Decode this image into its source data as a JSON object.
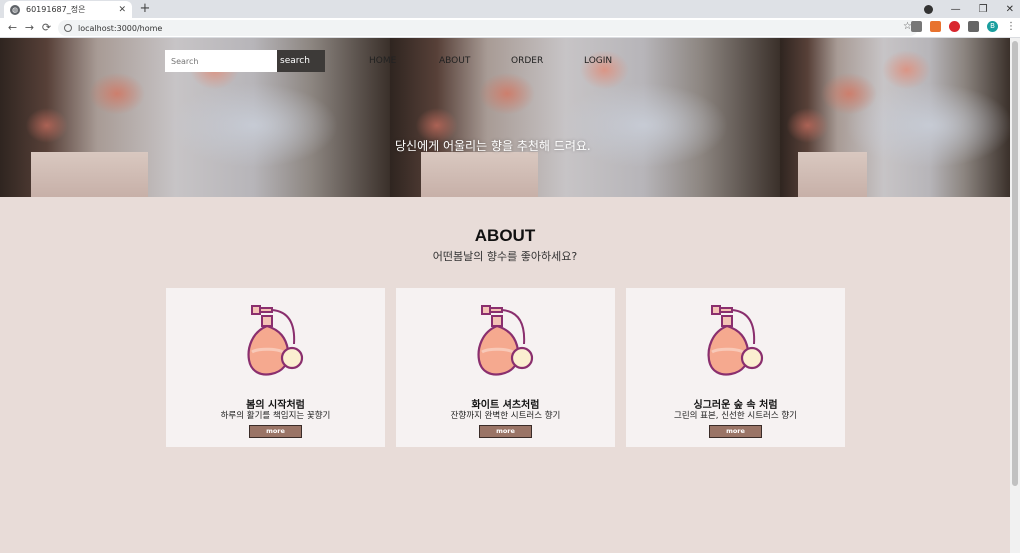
{
  "browser": {
    "tab_title": "60191687_정은",
    "tab_close": "✕",
    "new_tab": "+",
    "url": "localhost:3000/home",
    "back": "←",
    "forward": "→",
    "reload": "⟳",
    "star": "☆",
    "minimize": "—",
    "restore": "❐",
    "close": "✕",
    "profile_initial": "B"
  },
  "nav": {
    "search_placeholder": "Search",
    "search_button": "search",
    "links": [
      "HOME",
      "ABOUT",
      "ORDER",
      "LOGIN"
    ]
  },
  "hero": {
    "caption": "당신에게 어울리는 향을 추천해 드려요."
  },
  "about": {
    "title": "ABOUT",
    "subtitle": "어떤봄날의 향수를 좋아하세요?"
  },
  "cards": [
    {
      "title": "봄의 시작처럼",
      "desc": "하루의 활기를 책임지는 꽃향기",
      "button": "more"
    },
    {
      "title": "화이트 셔츠처럼",
      "desc": "잔향까지 완벽한 시트러스 향기",
      "button": "more"
    },
    {
      "title": "싱그러운 숲 속 처럼",
      "desc": "그린의 표본, 신선한 시트러스 향기",
      "button": "more"
    }
  ],
  "colors": {
    "page_bg": "#e8dcd8",
    "card_bg": "#f6f2f2",
    "button_bg": "#9a7466",
    "search_button_bg": "#3d3a38"
  },
  "icons": {
    "card_icon": "perfume-bottle-icon"
  }
}
